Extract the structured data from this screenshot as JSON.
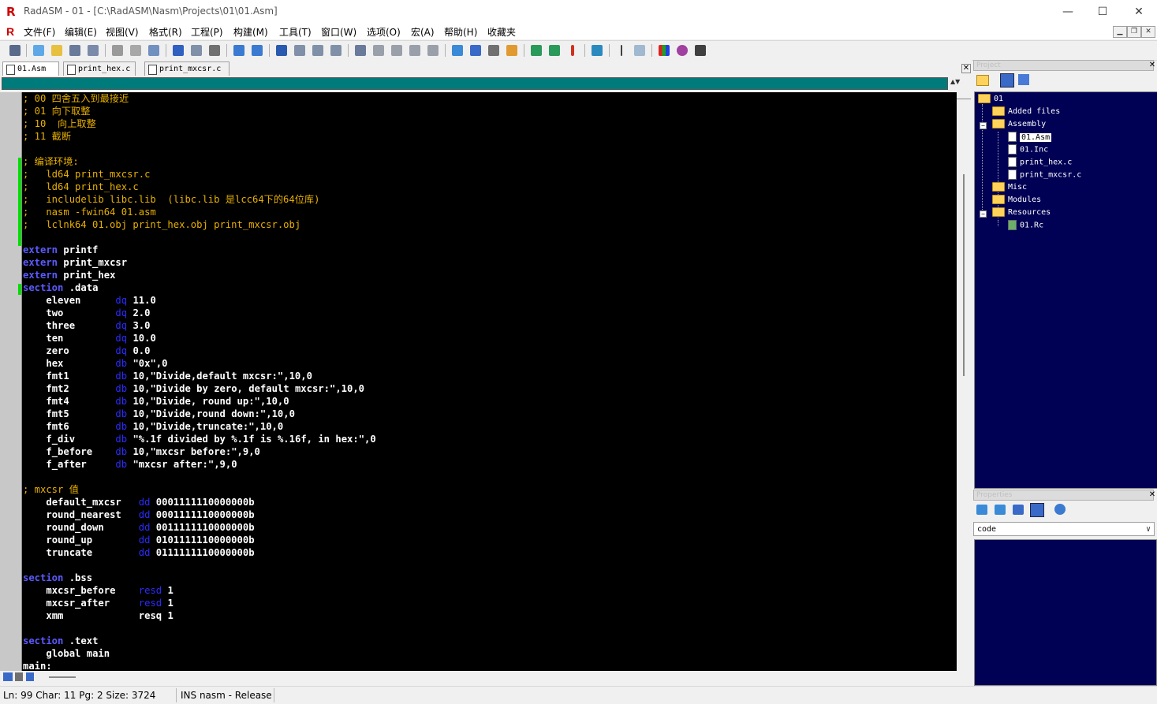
{
  "window": {
    "title": "RadASM - 01 - [C:\\RadASM\\Nasm\\Projects\\01\\01.Asm]",
    "minimize": "—",
    "maximize": "☐",
    "close": "✕"
  },
  "menu": {
    "items": [
      "文件(F)",
      "编辑(E)",
      "视图(V)",
      "格式(R)",
      "工程(P)",
      "构建(M)",
      "工具(T)",
      "窗口(W)",
      "选项(O)",
      "宏(A)",
      "帮助(H)",
      "收藏夹"
    ]
  },
  "mdi_controls": [
    "▁",
    "❐",
    "✕"
  ],
  "tabs": [
    {
      "label": "01.Asm"
    },
    {
      "label": "print_hex.c"
    },
    {
      "label": "print_mxcsr.c"
    }
  ],
  "editor": {
    "lines": [
      "; 00 四舍五入到最接近",
      "; 01 向下取整",
      "; 10  向上取整",
      "; 11 截断",
      "",
      "; 编译环境:",
      ";   ld64 print_mxcsr.c",
      ";   ld64 print_hex.c",
      ";   includelib libc.lib  (libc.lib 是lcc64下的64位库)",
      ";   nasm -fwin64 01.asm",
      ";   lclnk64 01.obj print_hex.obj print_mxcsr.obj",
      "",
      "extern printf",
      "extern print_mxcsr",
      "extern print_hex",
      "section .data",
      "    eleven      dq 11.0",
      "    two         dq 2.0",
      "    three       dq 3.0",
      "    ten         dq 10.0",
      "    zero        dq 0.0",
      "    hex         db \"0x\",0",
      "    fmt1        db 10,\"Divide,default mxcsr:\",10,0",
      "    fmt2        db 10,\"Divide by zero, default mxcsr:\",10,0",
      "    fmt4        db 10,\"Divide, round up:\",10,0",
      "    fmt5        db 10,\"Divide,round down:\",10,0",
      "    fmt6        db 10,\"Divide,truncate:\",10,0",
      "    f_div       db \"%.1f divided by %.1f is %.16f, in hex:\",0",
      "    f_before    db 10,\"mxcsr before:\",9,0",
      "    f_after     db \"mxcsr after:\",9,0",
      "",
      "; mxcsr 值",
      "    default_mxcsr   dd 0001111110000000b",
      "    round_nearest   dd 0001111110000000b",
      "    round_down      dd 0011111110000000b",
      "    round_up        dd 0101111110000000b",
      "    truncate        dd 0111111110000000b",
      "",
      "section .bss",
      "    mxcsr_before    resd 1",
      "    mxcsr_after     resd 1",
      "    xmm             resq 1",
      "",
      "section .text",
      "    global main",
      "main:"
    ]
  },
  "project": {
    "panel_title": "Project",
    "tree": {
      "root": "01",
      "added_files": "Added files",
      "assembly": "Assembly",
      "assembly_files": [
        "01.Asm",
        "01.Inc",
        "print_hex.c",
        "print_mxcsr.c"
      ],
      "misc": "Misc",
      "modules": "Modules",
      "resources": "Resources",
      "resource_files": [
        "01.Rc"
      ]
    }
  },
  "properties": {
    "panel_title": "Properties",
    "selected": "code"
  },
  "status": {
    "position": "Ln: 99 Char: 11 Pg: 2 Size: 3724",
    "mode": "INS nasm - Release"
  },
  "colors": {
    "editor_bg": "#000000",
    "comment": "#e8b000",
    "keyword": "#5a5aff",
    "tree_bg": "#000055",
    "tealbar": "#007b7b"
  }
}
